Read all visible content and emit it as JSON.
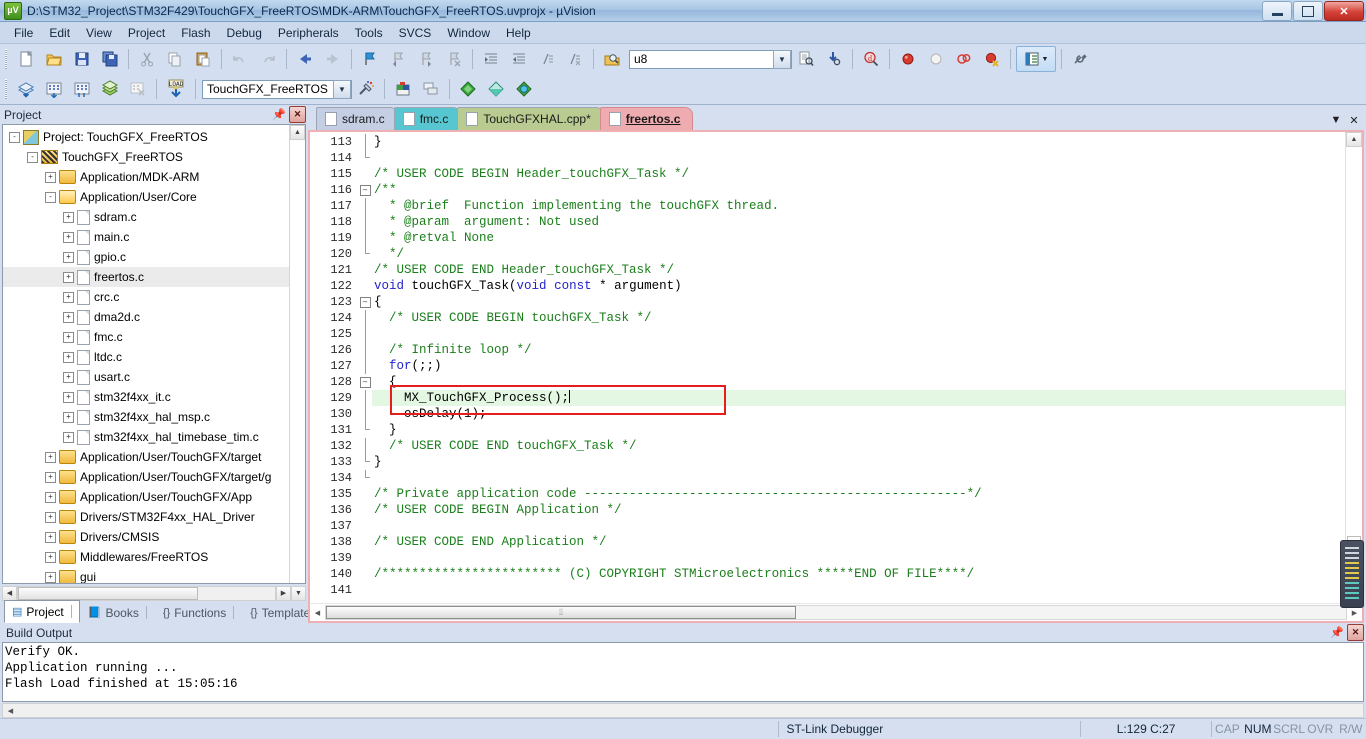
{
  "window": {
    "title": "D:\\STM32_Project\\STM32F429\\TouchGFX_FreeRTOS\\MDK-ARM\\TouchGFX_FreeRTOS.uvprojx - µVision",
    "app_icon": "uvision-icon",
    "minimize": "–",
    "restore": "❐",
    "close": "✕"
  },
  "menu": {
    "items": [
      "File",
      "Edit",
      "View",
      "Project",
      "Flash",
      "Debug",
      "Peripherals",
      "Tools",
      "SVCS",
      "Window",
      "Help"
    ]
  },
  "toolbar1": {
    "buttons": [
      {
        "name": "new-file-icon",
        "glyph": "📄"
      },
      {
        "name": "open-file-icon",
        "glyph": "📂"
      },
      {
        "name": "save-icon",
        "glyph": "💾"
      },
      {
        "name": "save-all-icon",
        "glyph": "🗐"
      },
      {
        "name": "cut-icon",
        "glyph": "✂"
      },
      {
        "name": "copy-icon",
        "glyph": "⧉"
      },
      {
        "name": "paste-icon",
        "glyph": "📋"
      },
      {
        "name": "undo-icon",
        "glyph": "↶"
      },
      {
        "name": "redo-icon",
        "glyph": "↷"
      },
      {
        "name": "navigate-back-icon",
        "glyph": "⬅"
      },
      {
        "name": "navigate-forward-icon",
        "glyph": "➡"
      },
      {
        "name": "bookmark-toggle-icon",
        "glyph": "⚑"
      },
      {
        "name": "bookmark-prev-icon",
        "glyph": "⚐"
      },
      {
        "name": "bookmark-next-icon",
        "glyph": "⚐"
      },
      {
        "name": "bookmark-clear-icon",
        "glyph": "⚐"
      },
      {
        "name": "indent-icon",
        "glyph": "⇥"
      },
      {
        "name": "outdent-icon",
        "glyph": "⇤"
      },
      {
        "name": "comment-icon",
        "glyph": "≡"
      },
      {
        "name": "uncomment-icon",
        "glyph": "≢"
      },
      {
        "name": "find-in-files-icon",
        "glyph": "🔎"
      }
    ],
    "search_value": "u8",
    "search_placeholder": "",
    "after_buttons": [
      {
        "name": "find-next-icon",
        "glyph": "🔍"
      },
      {
        "name": "incremental-find-icon",
        "glyph": "🔭"
      },
      {
        "name": "debug-find-icon",
        "glyph": "ⓓ"
      },
      {
        "name": "insert-breakpoint-icon",
        "glyph": "●"
      },
      {
        "name": "disable-breakpoint-icon",
        "glyph": "○"
      },
      {
        "name": "disable-all-breakpoints-icon",
        "glyph": "◍"
      },
      {
        "name": "kill-all-breakpoints-icon",
        "glyph": "◉"
      },
      {
        "name": "project-window-icon",
        "glyph": "▤"
      },
      {
        "name": "configure-icon",
        "glyph": "🔧"
      }
    ]
  },
  "toolbar2": {
    "buttons": [
      {
        "name": "translate-icon",
        "glyph": "◈"
      },
      {
        "name": "build-icon",
        "glyph": "▦"
      },
      {
        "name": "rebuild-icon",
        "glyph": "▦"
      },
      {
        "name": "batch-build-icon",
        "glyph": "≋"
      },
      {
        "name": "stop-build-icon",
        "glyph": "▩"
      },
      {
        "name": "load-icon",
        "glyph": "LOAD"
      }
    ],
    "target_value": "TouchGFX_FreeRTOS",
    "after_buttons": [
      {
        "name": "target-options-icon",
        "glyph": "✨"
      },
      {
        "name": "manage-project-items-icon",
        "glyph": "▮"
      },
      {
        "name": "multi-project-icon",
        "glyph": "❐"
      },
      {
        "name": "pack-installer-icon",
        "glyph": "◆"
      },
      {
        "name": "manage-run-time-env-icon",
        "glyph": "◇"
      },
      {
        "name": "select-software-packs-icon",
        "glyph": "◈"
      }
    ]
  },
  "project_panel": {
    "caption": "Project",
    "pin_icon": "pin-icon",
    "close_icon": "close-icon",
    "tree": [
      {
        "depth": 0,
        "label": "Project: TouchGFX_FreeRTOS",
        "icon": "project-icon",
        "expander": "-"
      },
      {
        "depth": 1,
        "label": "TouchGFX_FreeRTOS",
        "icon": "target-icon",
        "expander": "-"
      },
      {
        "depth": 2,
        "label": "Application/MDK-ARM",
        "icon": "folder-icon",
        "expander": "+"
      },
      {
        "depth": 2,
        "label": "Application/User/Core",
        "icon": "folder-open-icon",
        "expander": "-"
      },
      {
        "depth": 3,
        "label": "sdram.c",
        "icon": "file-icon",
        "expander": "+"
      },
      {
        "depth": 3,
        "label": "main.c",
        "icon": "file-icon",
        "expander": "+"
      },
      {
        "depth": 3,
        "label": "gpio.c",
        "icon": "file-icon",
        "expander": "+"
      },
      {
        "depth": 3,
        "label": "freertos.c",
        "icon": "file-icon",
        "expander": "+",
        "selected": true
      },
      {
        "depth": 3,
        "label": "crc.c",
        "icon": "file-icon",
        "expander": "+"
      },
      {
        "depth": 3,
        "label": "dma2d.c",
        "icon": "file-icon",
        "expander": "+"
      },
      {
        "depth": 3,
        "label": "fmc.c",
        "icon": "file-icon",
        "expander": "+"
      },
      {
        "depth": 3,
        "label": "ltdc.c",
        "icon": "file-icon",
        "expander": "+"
      },
      {
        "depth": 3,
        "label": "usart.c",
        "icon": "file-modified-icon",
        "expander": "+"
      },
      {
        "depth": 3,
        "label": "stm32f4xx_it.c",
        "icon": "file-icon",
        "expander": "+"
      },
      {
        "depth": 3,
        "label": "stm32f4xx_hal_msp.c",
        "icon": "file-icon",
        "expander": "+"
      },
      {
        "depth": 3,
        "label": "stm32f4xx_hal_timebase_tim.c",
        "icon": "file-icon",
        "expander": "+"
      },
      {
        "depth": 2,
        "label": "Application/User/TouchGFX/target",
        "icon": "folder-icon",
        "expander": "+"
      },
      {
        "depth": 2,
        "label": "Application/User/TouchGFX/target/g",
        "icon": "folder-icon",
        "expander": "+"
      },
      {
        "depth": 2,
        "label": "Application/User/TouchGFX/App",
        "icon": "folder-icon",
        "expander": "+"
      },
      {
        "depth": 2,
        "label": "Drivers/STM32F4xx_HAL_Driver",
        "icon": "folder-icon",
        "expander": "+"
      },
      {
        "depth": 2,
        "label": "Drivers/CMSIS",
        "icon": "folder-icon",
        "expander": "+"
      },
      {
        "depth": 2,
        "label": "Middlewares/FreeRTOS",
        "icon": "folder-icon",
        "expander": "+"
      },
      {
        "depth": 2,
        "label": "gui",
        "icon": "folder-icon",
        "expander": "+"
      }
    ],
    "tabs": [
      {
        "label": "Project",
        "icon": "project-tab-icon",
        "active": true
      },
      {
        "label": "Books",
        "icon": "books-tab-icon",
        "active": false
      },
      {
        "label": "Functions",
        "icon": "functions-tab-icon",
        "active": false
      },
      {
        "label": "Templates",
        "icon": "templates-tab-icon",
        "active": false
      }
    ]
  },
  "editor": {
    "tabs": [
      {
        "label": "sdram.c",
        "active": false
      },
      {
        "label": "fmc.c",
        "active": false
      },
      {
        "label": "TouchGFXHAL.cpp*",
        "active": false
      },
      {
        "label": "freertos.c",
        "active": true
      }
    ],
    "tab_controls": [
      {
        "name": "tab-list-dropdown-icon",
        "glyph": "▼"
      },
      {
        "name": "close-document-icon",
        "glyph": "✕"
      }
    ],
    "first_line_number": 113,
    "lines": [
      {
        "n": 113,
        "text": "}",
        "fold": "line"
      },
      {
        "n": 114,
        "text": "",
        "fold": "end"
      },
      {
        "n": 115,
        "text": "/* USER CODE BEGIN Header_touchGFX_Task */",
        "cls": "cm"
      },
      {
        "n": 116,
        "text": "/**",
        "cls": "cm",
        "fold": "box-minus"
      },
      {
        "n": 117,
        "text": "  * @brief  Function implementing the touchGFX thread.",
        "cls": "cm",
        "fold": "line"
      },
      {
        "n": 118,
        "text": "  * @param  argument: Not used",
        "cls": "cm",
        "fold": "line"
      },
      {
        "n": 119,
        "text": "  * @retval None",
        "cls": "cm",
        "fold": "line"
      },
      {
        "n": 120,
        "text": "  */",
        "cls": "cm",
        "fold": "end"
      },
      {
        "n": 121,
        "text": "/* USER CODE END Header_touchGFX_Task */",
        "cls": "cm"
      },
      {
        "n": 122,
        "text": "void touchGFX_Task(void const * argument)",
        "cls": "code-decl"
      },
      {
        "n": 123,
        "text": "{",
        "fold": "box-minus"
      },
      {
        "n": 124,
        "text": "  /* USER CODE BEGIN touchGFX_Task */",
        "cls": "cm",
        "fold": "line"
      },
      {
        "n": 125,
        "text": "",
        "fold": "line"
      },
      {
        "n": 126,
        "text": "  /* Infinite loop */",
        "cls": "cm",
        "fold": "line"
      },
      {
        "n": 127,
        "text": "  for(;;)",
        "cls": "code-for",
        "fold": "line"
      },
      {
        "n": 128,
        "text": "  {",
        "fold": "box-minus"
      },
      {
        "n": 129,
        "text": "    MX_TouchGFX_Process();",
        "highlight": true,
        "caret": true,
        "fold": "line"
      },
      {
        "n": 130,
        "text": "    osDelay(1);",
        "fold": "line"
      },
      {
        "n": 131,
        "text": "  }",
        "fold": "end"
      },
      {
        "n": 132,
        "text": "  /* USER CODE END touchGFX_Task */",
        "cls": "cm",
        "fold": "line"
      },
      {
        "n": 133,
        "text": "}",
        "fold": "end"
      },
      {
        "n": 134,
        "text": "",
        "fold": "end"
      },
      {
        "n": 135,
        "text": "/* Private application code ---------------------------------------------------*/",
        "cls": "cm"
      },
      {
        "n": 136,
        "text": "/* USER CODE BEGIN Application */",
        "cls": "cm"
      },
      {
        "n": 137,
        "text": ""
      },
      {
        "n": 138,
        "text": "/* USER CODE END Application */",
        "cls": "cm"
      },
      {
        "n": 139,
        "text": ""
      },
      {
        "n": 140,
        "text": "/************************ (C) COPYRIGHT STMicroelectronics *****END OF FILE****/",
        "cls": "cm"
      },
      {
        "n": 141,
        "text": ""
      }
    ],
    "annotation": {
      "name": "red-highlight-box",
      "color": "#e51d1d",
      "target_line": 129
    }
  },
  "build_output": {
    "caption": "Build Output",
    "pin_icon": "pin-icon",
    "close_icon": "close-icon",
    "lines": [
      "Verify OK.",
      "Application running ...",
      "Flash Load finished at 15:05:16"
    ]
  },
  "status_bar": {
    "debugger": "ST-Link Debugger",
    "position": "L:129 C:27",
    "indicators": [
      {
        "label": "CAP",
        "active": false
      },
      {
        "label": "NUM",
        "active": true
      },
      {
        "label": "SCRL",
        "active": false
      },
      {
        "label": "OVR",
        "active": false
      },
      {
        "label": "R/W",
        "active": false
      }
    ]
  },
  "colors": {
    "comment_green": "#1a7f1a",
    "keyword_blue": "#2222cc",
    "highlight_line": "#e3f7e3",
    "annotation_red": "#e51d1d",
    "active_tab_pink": "#efacb0"
  }
}
